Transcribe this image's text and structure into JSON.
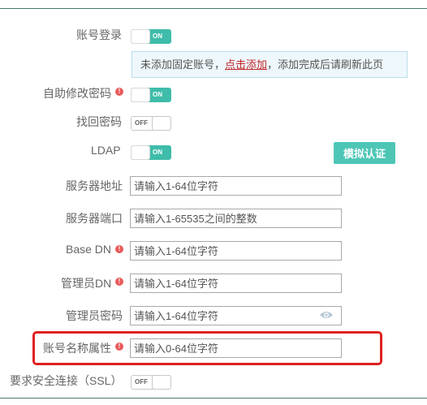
{
  "account_login": {
    "label": "账号登录",
    "state": "ON",
    "enabled": true
  },
  "notice": {
    "prefix": "未添加固定账号，",
    "link": "点击添加",
    "suffix": "，添加完成后请刷新此页"
  },
  "self_change_password": {
    "label": "自助修改密码",
    "info": "!",
    "state": "ON",
    "enabled": true
  },
  "retrieve_password": {
    "label": "找回密码",
    "state": "OFF",
    "enabled": false
  },
  "ldap": {
    "label": "LDAP",
    "state": "ON",
    "enabled": true,
    "test_button": "模拟认证"
  },
  "server_address": {
    "label": "服务器地址",
    "placeholder": "请输入1-64位字符"
  },
  "server_port": {
    "label": "服务器端口",
    "placeholder": "请输入1-65535之间的整数"
  },
  "base_dn": {
    "label": "Base DN",
    "info": "!",
    "placeholder": "请输入1-64位字符"
  },
  "admin_dn": {
    "label": "管理员DN",
    "info": "!",
    "placeholder": "请输入1-64位字符"
  },
  "admin_password": {
    "label": "管理员密码",
    "placeholder": "请输入1-64位字符"
  },
  "account_name_attr": {
    "label": "账号名称属性",
    "info": "!",
    "placeholder": "请输入0-64位字符"
  },
  "require_ssl": {
    "label": "要求安全连接（SSL）",
    "state": "OFF",
    "enabled": false
  },
  "colors": {
    "toggle_on": "#3fbcaa",
    "button": "#4ec6b6",
    "link": "#c0282b",
    "highlight": "#e02020"
  }
}
